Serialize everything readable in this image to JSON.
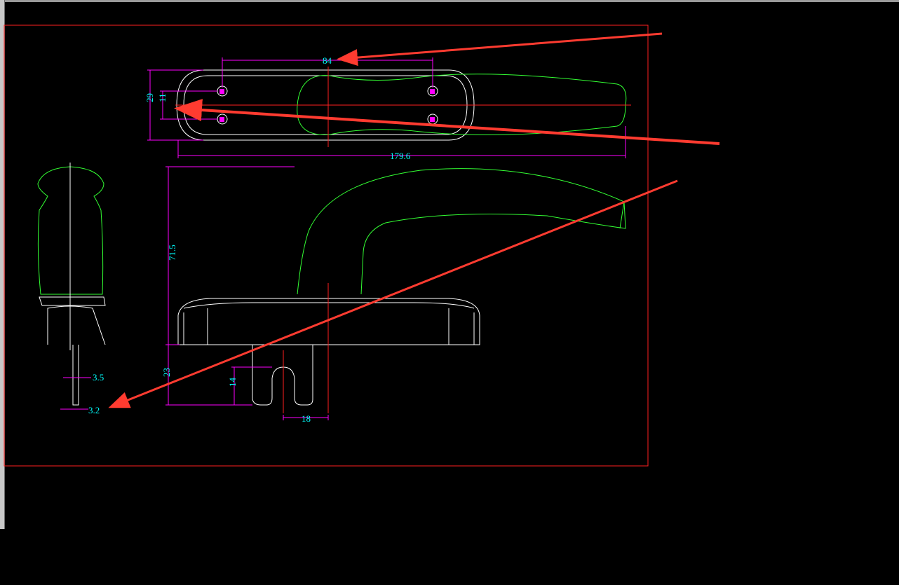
{
  "colors": {
    "background": "#000000",
    "border": "#ff2020",
    "outline": "#ffffff",
    "profile": "#33ff33",
    "dimension": "#ff00ff",
    "dimension_text": "#00ffff",
    "centerline": "#ff2020",
    "annotation_arrow": "#ff3b30"
  },
  "dimensions": {
    "d84": "84",
    "d29": "29",
    "d11": "11",
    "d179": "179.6",
    "d71": "71.5",
    "d23": "23",
    "d14": "14",
    "d18": "18",
    "d35": "3.5",
    "d32": "3.2"
  }
}
